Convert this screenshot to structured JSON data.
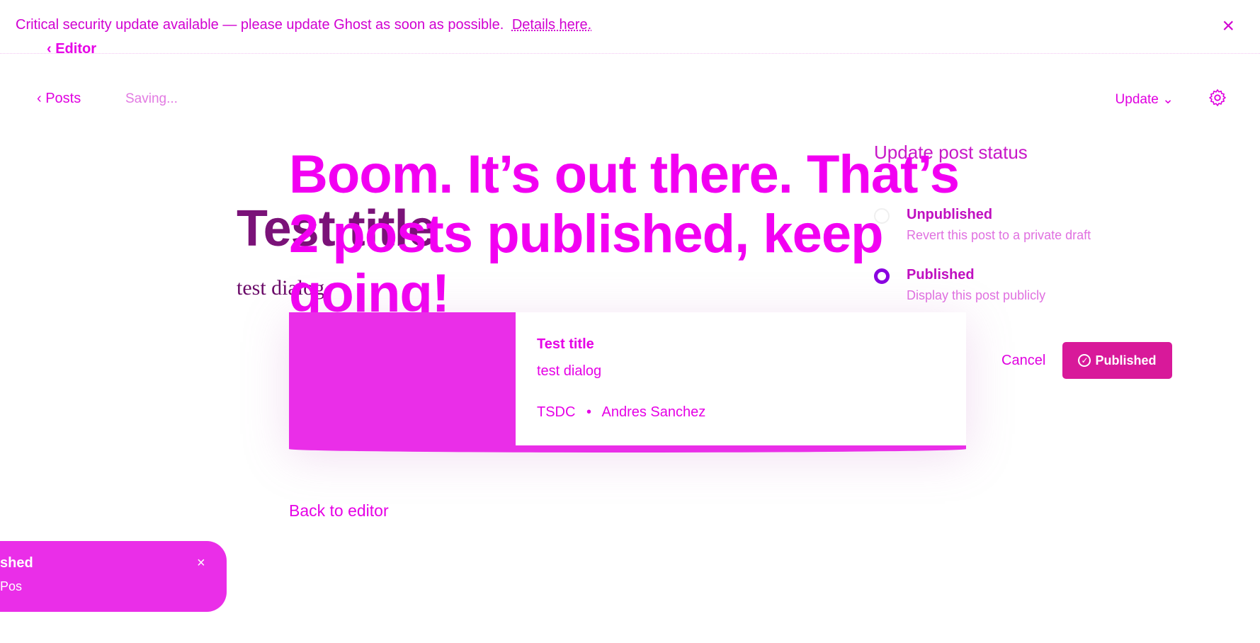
{
  "banner": {
    "text": "Critical security update available — please update Ghost as soon as possible.",
    "link": "Details here.",
    "close_icon": "close-icon"
  },
  "nav": {
    "editor_back": "‹  Editor",
    "posts_back": "‹  Posts",
    "saving": "Saving...",
    "update": "Update ⌄",
    "settings_icon": "gear-icon"
  },
  "post": {
    "title": "Test title",
    "body": "test dialog"
  },
  "publish_dialog": {
    "headline": "Boom. It’s out there. That’s 2 posts published, keep going!",
    "card": {
      "title": "Test title",
      "excerpt": "test dialog",
      "site": "TSDC",
      "separator": "•",
      "author": "Andres Sanchez"
    },
    "back_to_editor": "Back to editor"
  },
  "status_panel": {
    "title": "Update post status",
    "options": [
      {
        "label": "Unpublished",
        "description": "Revert this post to a private draft",
        "selected": false
      },
      {
        "label": "Published",
        "description": "Display this post publicly",
        "selected": true
      }
    ],
    "cancel": "Cancel",
    "confirm": "Published"
  },
  "toast": {
    "title": "shed",
    "link": "Pos",
    "close": "×"
  },
  "colors": {
    "accent": "#e600e6",
    "button": "#d8199a",
    "title_text": "#7a1278"
  }
}
